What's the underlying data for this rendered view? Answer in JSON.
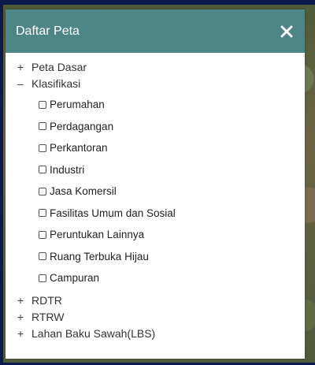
{
  "panel": {
    "title": "Daftar Peta",
    "close_icon": "close-icon",
    "tree": [
      {
        "toggle": "+",
        "label": "Peta Dasar"
      },
      {
        "toggle": "–",
        "label": "Klasifikasi"
      }
    ],
    "klasifikasi_items": [
      {
        "label": "Perumahan",
        "checked": false
      },
      {
        "label": "Perdagangan",
        "checked": false
      },
      {
        "label": "Perkantoran",
        "checked": false
      },
      {
        "label": "Industri",
        "checked": false
      },
      {
        "label": "Jasa Komersil",
        "checked": false
      },
      {
        "label": "Fasilitas Umum dan Sosial",
        "checked": false
      },
      {
        "label": "Peruntukan Lainnya",
        "checked": false
      },
      {
        "label": "Ruang Terbuka Hijau",
        "checked": false
      },
      {
        "label": "Campuran",
        "checked": false
      }
    ],
    "tree_after": [
      {
        "toggle": "+",
        "label": "RDTR"
      },
      {
        "toggle": "+",
        "label": "RTRW"
      },
      {
        "toggle": "+",
        "label": "Lahan Baku Sawah(LBS)"
      }
    ]
  },
  "colors": {
    "header_bg": "#4e8585",
    "frame": "#0b1a4a"
  }
}
